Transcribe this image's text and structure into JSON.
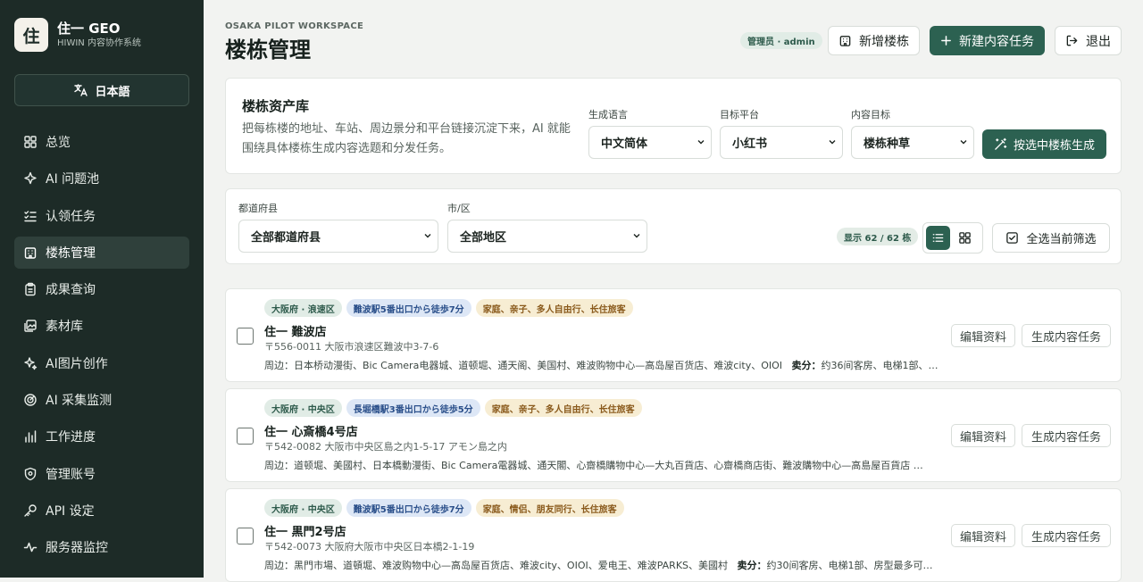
{
  "sidebar": {
    "logo_char": "住",
    "brand_title": "住一 GEO",
    "brand_sub": "HIWIN 内容协作系统",
    "lang_button": "日本語",
    "items": [
      {
        "label": "总览",
        "icon": "grid-icon",
        "active": false
      },
      {
        "label": "AI 问题池",
        "icon": "sparkle-icon",
        "active": false
      },
      {
        "label": "认领任务",
        "icon": "checklist-icon",
        "active": false
      },
      {
        "label": "楼栋管理",
        "icon": "building-icon",
        "active": true
      },
      {
        "label": "成果查询",
        "icon": "clipboard-icon",
        "active": false
      },
      {
        "label": "素材库",
        "icon": "image-stack-icon",
        "active": false
      },
      {
        "label": "AI图片创作",
        "icon": "sparkle-icon",
        "active": false
      },
      {
        "label": "AI 采集监测",
        "icon": "radar-icon",
        "active": false
      },
      {
        "label": "工作进度",
        "icon": "bar-chart-icon",
        "active": false
      },
      {
        "label": "管理账号",
        "icon": "shield-icon",
        "active": false
      },
      {
        "label": "API 设定",
        "icon": "key-icon",
        "active": false
      },
      {
        "label": "服务器监控",
        "icon": "activity-icon",
        "active": false
      }
    ]
  },
  "header": {
    "eyebrow": "OSAKA PILOT WORKSPACE",
    "title": "楼栋管理",
    "admin_badge": "管理员 · admin",
    "add_building": "新增楼栋",
    "new_task": "新建内容任务",
    "logout": "退出"
  },
  "library": {
    "title": "楼栋资产库",
    "desc": "把每栋楼的地址、车站、周边景分和平台链接沉淀下来，AI 就能围绕具体楼栋生成内容选题和分发任务。",
    "lang_label": "生成语言",
    "lang_value": "中文简体",
    "platform_label": "目标平台",
    "platform_value": "小红书",
    "goal_label": "内容目标",
    "goal_value": "楼栋种草",
    "generate_button": "按选中楼栋生成"
  },
  "filters": {
    "pref_label": "都道府县",
    "pref_value": "全部都道府县",
    "city_label": "市/区",
    "city_value": "全部地区",
    "count_badge": "显示 62 / 62 栋",
    "view_mode": "list",
    "select_all": "全选当前筛选"
  },
  "buildings": [
    {
      "tag_area": "大阪府 · 浪速区",
      "tag_station": "難波駅5番出口から徒歩7分",
      "tag_audience": "家庭、亲子、多人自由行、长住旅客",
      "name": "住一 難波店",
      "address": "〒556-0011 大阪市浪速区難波中3-7-6",
      "near_label": "周边：",
      "near": "日本桥动漫街、Bic Camera电器城、道顿堀、通天阁、美国村、难波购物中心—高岛屋百货店、难波city、OIOI",
      "sell_label": "卖分：",
      "sell": "约36间客房、电梯1部、…",
      "edit": "编辑资料",
      "create": "生成内容任务"
    },
    {
      "tag_area": "大阪府 · 中央区",
      "tag_station": "長堀橋駅3番出口から徒歩5分",
      "tag_audience": "家庭、亲子、多人自由行、长住旅客",
      "name": "住一 心斎橋4号店",
      "address": "〒542-0082 大阪市中央区島之内1-5-17 アモン島之内",
      "near_label": "周边：",
      "near": "道顿堀、美國村、日本橋動漫街、Bic Camera電器城、通天閣、心齋橋購物中心—大丸百貨店、心齋橋商店街、難波購物中心—高島屋百貨店 …",
      "sell_label": "",
      "sell": "",
      "edit": "编辑资料",
      "create": "生成内容任务"
    },
    {
      "tag_area": "大阪府 · 中央区",
      "tag_station": "難波駅5番出口から徒歩7分",
      "tag_audience": "家庭、情侣、朋友同行、长住旅客",
      "name": "住一 黒門2号店",
      "address": "〒542-0073 大阪府大阪市中央区日本橋2-1-19",
      "near_label": "周边：",
      "near": "黑門市場、道頓堀、难波购物中心—高岛屋百货店、难波city、OIOI、爱电王、难波PARKS、美國村",
      "sell_label": "卖分：",
      "sell": "约30间客房、电梯1部、房型最多可…",
      "edit": "编辑资料",
      "create": "生成内容任务"
    }
  ]
}
